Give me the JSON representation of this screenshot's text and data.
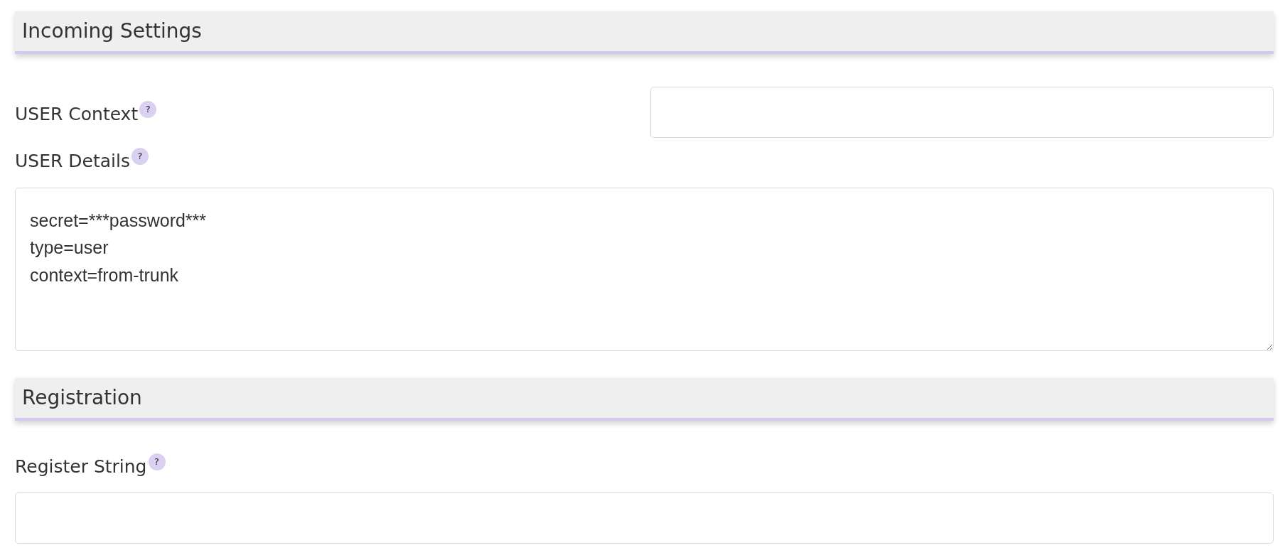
{
  "sections": [
    {
      "title": "Incoming Settings",
      "fields": [
        {
          "kind": "inline-text",
          "label": "USER Context",
          "help": "?"
        },
        {
          "kind": "textarea",
          "label": "USER Details",
          "help": "?",
          "value": "secret=***password***\ntype=user\ncontext=from-trunk"
        }
      ]
    },
    {
      "title": "Registration",
      "fields": [
        {
          "kind": "text",
          "label": "Register String",
          "help": "?"
        }
      ]
    }
  ]
}
